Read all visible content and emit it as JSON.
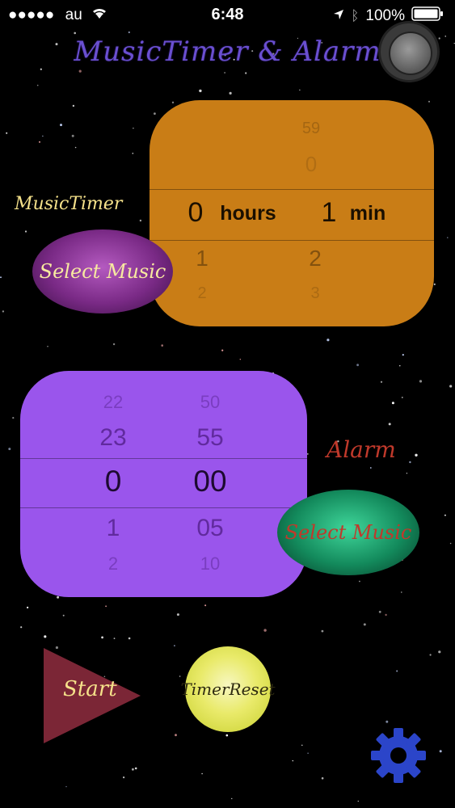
{
  "status_bar": {
    "carrier": "au",
    "time": "6:48",
    "battery": "100%"
  },
  "app": {
    "title": "MusicTimer & Alarm"
  },
  "timer": {
    "label": "MusicTimer",
    "hours_rows": [
      "",
      "",
      "0",
      "1",
      "2"
    ],
    "minutes_rows": [
      "59",
      "0",
      "1",
      "2",
      "3"
    ],
    "hours_unit": "hours",
    "minutes_unit": "min",
    "select_music_label": "Select Music"
  },
  "alarm": {
    "label": "Alarm",
    "hour_rows": [
      "22",
      "23",
      "0",
      "1",
      "2"
    ],
    "minute_rows": [
      "50",
      "55",
      "00",
      "05",
      "10"
    ],
    "select_music_label": "Select Music"
  },
  "controls": {
    "start_label": "Start",
    "reset_label": "TimerReset"
  },
  "icons": {
    "settings": "gear-icon",
    "assistive_touch": "assistive-touch-icon",
    "signal": "signal-dots-icon",
    "wifi": "wifi-icon",
    "location": "location-arrow-icon",
    "bluetooth": "bluetooth-icon",
    "battery": "battery-icon"
  },
  "colors": {
    "timer_card": "#c97d16",
    "alarm_card": "#9a55ec",
    "title": "#6a4fd0",
    "start_triangle": "#7b2636",
    "settings_gear": "#2b45c9"
  }
}
